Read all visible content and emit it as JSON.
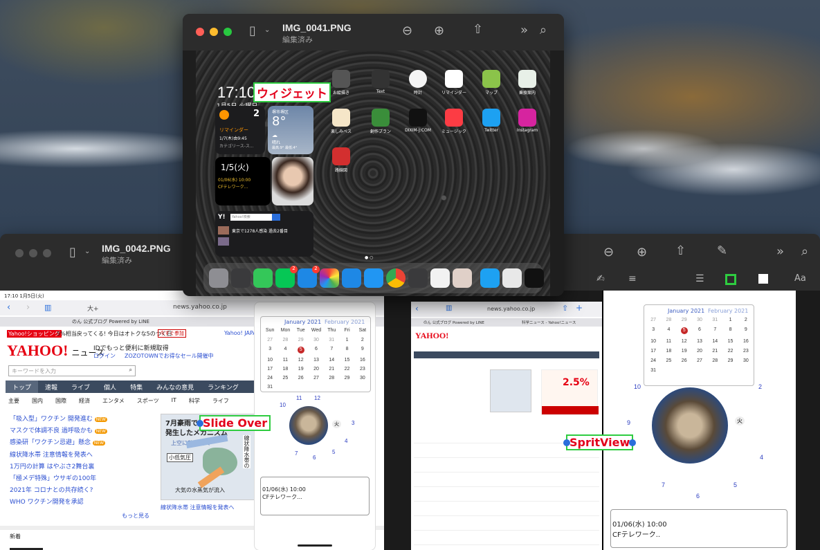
{
  "front_window": {
    "title": "IMG_0041.PNG",
    "subtitle": "編集済み",
    "ipad": {
      "time": "17:10",
      "date": "1月5日 火曜日",
      "callout": "ウィジェット",
      "reminder_count": "2",
      "reminder_title": "リマインダー",
      "reminder_line1": "1/7(木)由9:45",
      "reminder_line2": "カテゴリース-ス...",
      "weather_city": "堺市堺区",
      "weather_temp": "8°",
      "weather_line1": "晴れ",
      "weather_line2": "最高:9° 最低:4°",
      "cal_date": "1/5(火)",
      "cal_event1": "01/06(水) 10:00",
      "cal_event2": "CFテレワーク...",
      "yahoo_search": "Yahoo!検索",
      "yahoo_headline": "東京で1278人感染 過去2番目",
      "apps": [
        {
          "label": "お絵描き",
          "color": "#555"
        },
        {
          "label": "Text",
          "color": "#333"
        },
        {
          "label": "時計",
          "color": "#f4f4f4"
        },
        {
          "label": "リマインダー",
          "color": "#fff"
        },
        {
          "label": "マップ",
          "color": "#8bc34a"
        },
        {
          "label": "乗換案内",
          "color": "#e8f0e8"
        },
        {
          "label": "楽しみベス",
          "color": "#f5e6c8"
        },
        {
          "label": "創作プラン",
          "color": "#3a8e3a"
        },
        {
          "label": "DIXIM-J:COM",
          "color": "#111"
        },
        {
          "label": "ミュージック",
          "color": "#fc3c44"
        },
        {
          "label": "Twitter",
          "color": "#1da1f2"
        },
        {
          "label": "Instagram",
          "color": "#d6249f"
        },
        {
          "label": "路線図",
          "color": "#d32f2f"
        }
      ],
      "dock_badge_line": "2",
      "dock_badge_mail": "2"
    }
  },
  "back_window": {
    "title": "IMG_0042.PNG",
    "subtitle": "編集済み",
    "status_time": "17:10   1月5日(火)",
    "slide_over_callout": "Slide Over",
    "split_view_callout": "SpritView",
    "left_browser": {
      "tab_text": "大+",
      "url": "news.yahoo.co.jp",
      "tab_title": "のん 公式ブログ Powered by LINE",
      "promo": "5%相当戻ってくる! 今日はオトクな5のつく日",
      "promo_btn": "今すぐ参加",
      "shopping_badge": "Yahoo!ショッピング",
      "yahoo_japan_link": "Yahoo! JAPAN",
      "logo": "YAHOO!",
      "logo_sub": "ニュース",
      "login_text": "IDでもっと便利に新規取得",
      "login_link": "ログイン",
      "zozo": "ZOZOTOWNでお得なセール開催中",
      "search_placeholder": "キーワードを入力",
      "nav": [
        "トップ",
        "速報",
        "ライブ",
        "個人",
        "特集",
        "みんなの意見",
        "ランキング"
      ],
      "subnav": [
        "主要",
        "国内",
        "国際",
        "経済",
        "エンタメ",
        "スポーツ",
        "IT",
        "科学",
        "ライフ"
      ],
      "headlines": [
        "「吸入型」ワクチン 開発進む",
        "マスクで体調不良 過呼吸かも",
        "感染研「ワクチン忌避」懸念",
        "線状降水帯 注意情報を発表へ",
        "1万円の計算 はやぶさ2舞台裏",
        "「極メデ特殊」ウサギの100年",
        "2021年 コロナとの共存続く?",
        "WHO ワクチン開発を承認"
      ],
      "new_badge": "NEW",
      "more": "もっと見る",
      "map_title1": "7月豪雨で線",
      "map_title2": "発生したメカニズム",
      "map_l1": "上空に乾気流入",
      "map_l2": "小低気圧",
      "map_l3": "大気の水蒸気が流入",
      "map_side": "線状降水帯の",
      "map_caption": "線状降水帯 注意情報を発表へ",
      "section": "新着"
    },
    "slide_over": {
      "month1": "January 2021",
      "month2": "February 2021",
      "weekdays": [
        "Sun",
        "Mon",
        "Tue",
        "Wed",
        "Thu",
        "Fri",
        "Sat"
      ],
      "days": [
        "27",
        "28",
        "29",
        "30",
        "31",
        "1",
        "2",
        "3",
        "4",
        "5",
        "6",
        "7",
        "8",
        "9",
        "10",
        "11",
        "12",
        "13",
        "14",
        "15",
        "16",
        "17",
        "18",
        "19",
        "20",
        "21",
        "22",
        "23",
        "24",
        "25",
        "26",
        "27",
        "28",
        "29",
        "30",
        "31"
      ],
      "today": "5",
      "event1": "01/06(水) 10:00",
      "event2": "CFテレワーク..."
    },
    "split_browser": {
      "url": "news.yahoo.co.jp",
      "tab1": "のん 公式ブログ Powered by LINE",
      "tab2": "科学ニュース - Yahoo!ニュース",
      "headline": "2.5%"
    },
    "split_right": {
      "month1": "January 2021",
      "month2": "February 2021",
      "event1": "01/06(水) 10:00",
      "event2": "CFテレワーク.."
    }
  }
}
